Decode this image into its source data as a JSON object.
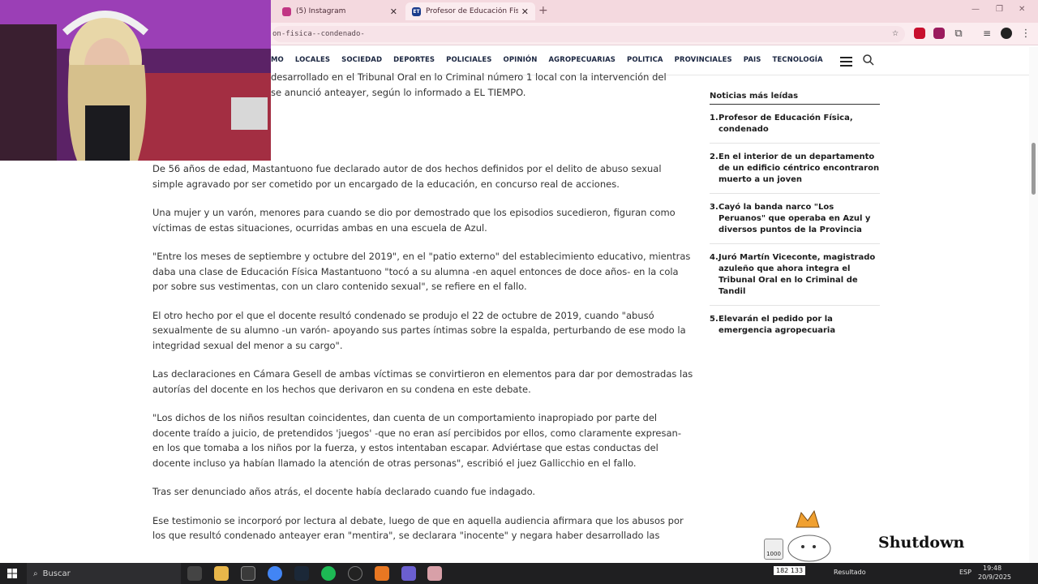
{
  "browser": {
    "tabs": [
      {
        "title": "(5) Instagram",
        "close": "✕",
        "favicon_color": "#c13584"
      },
      {
        "title": "Profesor de Educación Física, co",
        "close": "✕",
        "favicon_label": "ET",
        "favicon_color": "#1a3c8c"
      }
    ],
    "new_tab": "+",
    "window_controls": [
      "—",
      "❐",
      "✕"
    ],
    "url": "on-fisica--condenado-"
  },
  "site_nav": {
    "items": [
      "MO",
      "LOCALES",
      "SOCIEDAD",
      "DEPORTES",
      "POLICIALES",
      "OPINIÓN",
      "AGROPECUARIAS",
      "POLITICA",
      "PROVINCIALES",
      "PAIS",
      "TECNOLOGÍA"
    ]
  },
  "article": {
    "top_lines": [
      "desarrollado en el Tribunal Oral en lo Criminal número 1 local con la intervención del",
      "se anunció anteayer, según lo informado a EL TIEMPO."
    ],
    "paragraphs": [
      "De 56 años de edad, Mastantuono fue declarado autor de dos hechos definidos por el delito de abuso sexual simple agravado por ser cometido por un encargado de la educación, en concurso real de acciones.",
      "Una mujer y un varón, menores para cuando se dio por demostrado que los episodios sucedieron, figuran como víctimas de estas situaciones, ocurridas ambas en una escuela de Azul.",
      "\"Entre los meses de septiembre y octubre del 2019\", en el \"patio externo\" del establecimiento educativo, mientras daba una clase de Educación Física Mastantuono \"tocó a su alumna -en aquel entonces de doce años- en la cola por sobre sus vestimentas, con un claro contenido sexual\", se refiere en el fallo.",
      "El otro hecho por el que el docente resultó condenado se produjo el 22 de octubre de 2019, cuando \"abusó sexualmente de su alumno -un varón- apoyando sus partes íntimas sobre la espalda, perturbando de ese modo la integridad sexual del menor a su cargo\".",
      "Las declaraciones en Cámara Gesell de ambas víctimas se convirtieron en elementos para dar por demostradas las autorías del docente en los hechos que derivaron en su condena en este debate.",
      "\"Los dichos de los niños resultan coincidentes, dan cuenta de un comportamiento inapropiado por parte del docente traído a juicio, de pretendidos 'juegos' -que no eran así percibidos por ellos, como claramente expresan- en los que tomaba a los niños por la fuerza, y estos intentaban escapar. Adviértase que estas conductas del docente incluso ya habían llamado la atención de otras personas\", escribió el juez Gallicchio en el fallo.",
      "Tras ser denunciado años atrás, el docente había declarado cuando fue indagado.",
      "Ese testimonio se incorporó por lectura al debate, luego de que en aquella audiencia afirmara que los abusos por los que resultó condenado anteayer eran \"mentira\", se declarara \"inocente\" y negara haber desarrollado las"
    ]
  },
  "sidebar": {
    "title": "Noticias más leídas",
    "items": [
      {
        "num": "1.",
        "title": "Profesor de Educación Física, condenado"
      },
      {
        "num": "2.",
        "title": "En el interior de un departamento de un edificio céntrico encontraron muerto a un joven"
      },
      {
        "num": "3.",
        "title": "Cayó la banda narco \"Los Peruanos\" que operaba en Azul y diversos puntos de la Provincia"
      },
      {
        "num": "4.",
        "title": "Juró Martín Viceconte, magistrado azuleño que ahora integra el Tribunal Oral en lo Criminal de Tandil"
      },
      {
        "num": "5.",
        "title": "Elevarán el pedido por la emergencia agropecuaria"
      }
    ]
  },
  "stream_overlay": {
    "widget_text": "Shutdown",
    "counter": "1000"
  },
  "taskbar": {
    "search_placeholder": "Buscar",
    "tray_counter": "182 133",
    "app_label": "Resultado",
    "lang": "ESP",
    "time": "19:48",
    "date": "20/9/2025"
  }
}
